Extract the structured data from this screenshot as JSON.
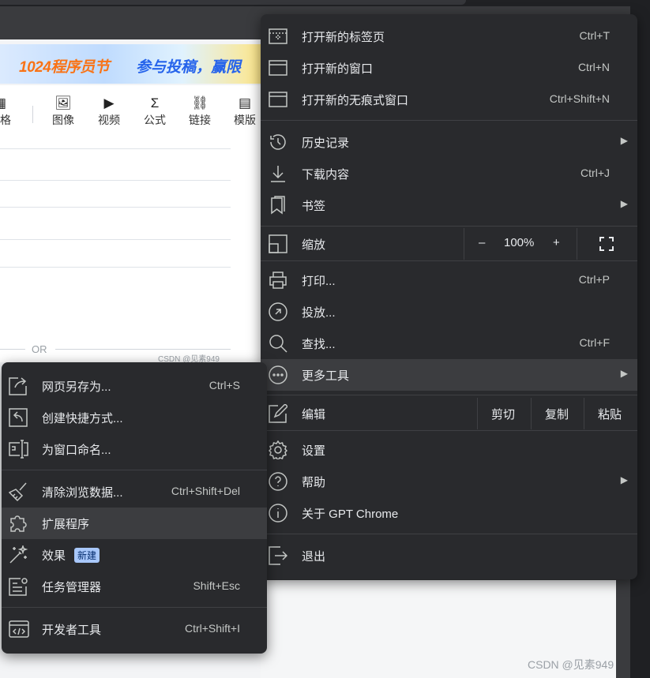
{
  "background": {
    "banner_text_1": "1024程序员节",
    "banner_text_2": "参与投稿，赢限",
    "toolbar": [
      {
        "label": "表格",
        "icon": "table-icon"
      },
      {
        "label": "图像",
        "icon": "image-icon"
      },
      {
        "label": "视频",
        "icon": "video-icon"
      },
      {
        "label": "公式",
        "icon": "sigma-icon"
      },
      {
        "label": "链接",
        "icon": "link-icon"
      },
      {
        "label": "模版",
        "icon": "template-icon"
      }
    ],
    "or_text": "OR",
    "csdn_small": "CSDN @见素949",
    "watermark": "CSDN @见素949"
  },
  "menu": {
    "new_tab": {
      "label": "打开新的标签页",
      "shortcut": "Ctrl+T"
    },
    "new_window": {
      "label": "打开新的窗口",
      "shortcut": "Ctrl+N"
    },
    "incognito": {
      "label": "打开新的无痕式窗口",
      "shortcut": "Ctrl+Shift+N"
    },
    "history": {
      "label": "历史记录"
    },
    "downloads": {
      "label": "下载内容",
      "shortcut": "Ctrl+J"
    },
    "bookmarks": {
      "label": "书签"
    },
    "zoom": {
      "label": "缩放",
      "minus": "–",
      "value": "100%",
      "plus": "+"
    },
    "print": {
      "label": "打印...",
      "shortcut": "Ctrl+P"
    },
    "cast": {
      "label": "投放..."
    },
    "find": {
      "label": "查找...",
      "shortcut": "Ctrl+F"
    },
    "more_tools": {
      "label": "更多工具"
    },
    "edit": {
      "label": "编辑",
      "cut": "剪切",
      "copy": "复制",
      "paste": "粘贴"
    },
    "settings": {
      "label": "设置"
    },
    "help": {
      "label": "帮助"
    },
    "about": {
      "label": "关于 GPT Chrome"
    },
    "exit": {
      "label": "退出"
    }
  },
  "submenu": {
    "save_page": {
      "label": "网页另存为...",
      "shortcut": "Ctrl+S"
    },
    "create_shortcut": {
      "label": "创建快捷方式..."
    },
    "name_window": {
      "label": "为窗口命名..."
    },
    "clear_data": {
      "label": "清除浏览数据...",
      "shortcut": "Ctrl+Shift+Del"
    },
    "extensions": {
      "label": "扩展程序"
    },
    "effects": {
      "label": "效果",
      "badge": "新建"
    },
    "task_manager": {
      "label": "任务管理器",
      "shortcut": "Shift+Esc"
    },
    "devtools": {
      "label": "开发者工具",
      "shortcut": "Ctrl+Shift+I"
    }
  },
  "colors": {
    "menu_bg": "#292a2d",
    "hover_bg": "#3c3d40",
    "text": "#e8eaed",
    "badge": "#a8c7fa"
  }
}
